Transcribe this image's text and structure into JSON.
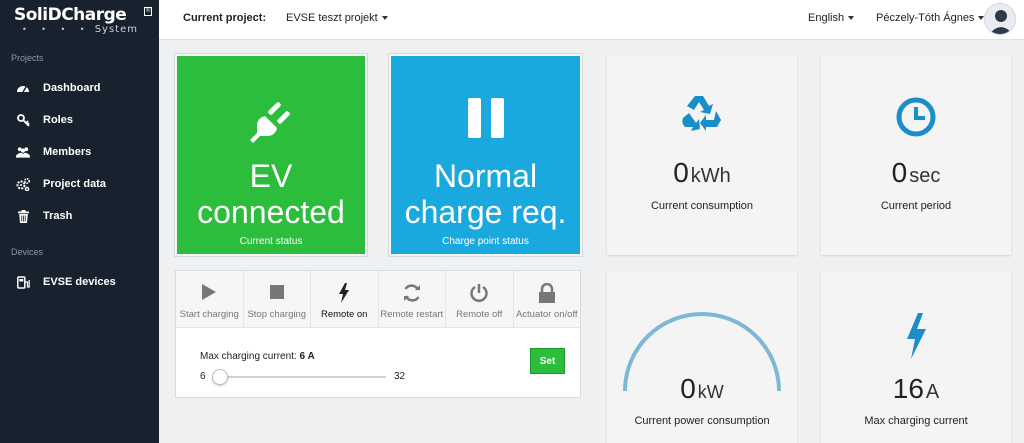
{
  "sidebar": {
    "logo": {
      "line1": "SoliDCharge",
      "line2": "System",
      "dots": "• • • •",
      "mark": "®"
    },
    "sections": {
      "projects": "Projects",
      "devices": "Devices"
    },
    "items": [
      {
        "label": "Dashboard",
        "icon": "dashboard-icon"
      },
      {
        "label": "Roles",
        "icon": "key-icon"
      },
      {
        "label": "Members",
        "icon": "users-icon"
      },
      {
        "label": "Project data",
        "icon": "gears-icon"
      },
      {
        "label": "Trash",
        "icon": "trash-icon"
      }
    ],
    "device_items": [
      {
        "label": "EVSE devices",
        "icon": "evse-device-icon"
      }
    ]
  },
  "topbar": {
    "project_label": "Current project:",
    "project_value": "EVSE teszt projekt",
    "language": "English",
    "user": "Péczely-Tóth Ágnes"
  },
  "status": {
    "current": {
      "line1": "EV",
      "line2": "connected",
      "caption": "Current status",
      "color": "#2dbd3d",
      "icon": "plug-icon"
    },
    "charge_point": {
      "line1": "Normal",
      "line2": "charge req.",
      "caption": "Charge point status",
      "color": "#1aa9de",
      "icon": "pause-icon"
    }
  },
  "stats": {
    "consumption": {
      "value": "0",
      "unit": "kWh",
      "caption": "Current consumption",
      "icon": "recycle-icon"
    },
    "period": {
      "value": "0",
      "unit": "sec",
      "caption": "Current period",
      "icon": "clock-icon"
    },
    "power": {
      "value": "0",
      "unit": "kW",
      "caption": "Current power consumption",
      "gauge_fraction": 0
    },
    "max_current": {
      "value": "16",
      "unit": "A",
      "caption": "Max charging current",
      "icon": "bolt-icon"
    }
  },
  "controls": [
    {
      "label": "Start charging",
      "icon": "play-icon",
      "active": false
    },
    {
      "label": "Stop charging",
      "icon": "stop-icon",
      "active": false
    },
    {
      "label": "Remote on",
      "icon": "bolt-icon",
      "active": true
    },
    {
      "label": "Remote restart",
      "icon": "refresh-icon",
      "active": false
    },
    {
      "label": "Remote off",
      "icon": "power-icon",
      "active": false
    },
    {
      "label": "Actuator on/off",
      "icon": "lock-icon",
      "active": false
    }
  ],
  "charging_current": {
    "label": "Max charging current:",
    "value_text": "6 A",
    "min": "6",
    "max": "32",
    "value": 6,
    "button": "Set"
  },
  "colors": {
    "sidebar": "#17222e",
    "accent_green": "#2dbd3d",
    "accent_blue": "#1aa9de",
    "icon_blue": "#1a8ec8"
  }
}
